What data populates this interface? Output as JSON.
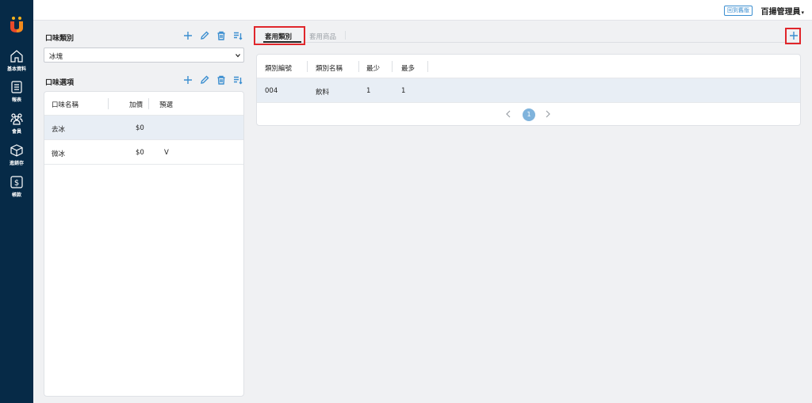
{
  "sidebar": {
    "items": [
      {
        "label": "基本資料",
        "icon": "home-icon"
      },
      {
        "label": "報表",
        "icon": "report-icon"
      },
      {
        "label": "會員",
        "icon": "members-icon"
      },
      {
        "label": "進銷存",
        "icon": "inventory-box-icon"
      },
      {
        "label": "帳款",
        "icon": "dollar-icon"
      }
    ]
  },
  "topbar": {
    "back_label": "回到舊版",
    "user_label": "百揚管理員",
    "caret": "▾"
  },
  "flavor_category": {
    "title": "口味類別",
    "selected": "冰塊"
  },
  "flavor_options": {
    "title": "口味選項",
    "columns": [
      "口味名稱",
      "加價",
      "預選"
    ],
    "rows": [
      {
        "name": "去冰",
        "price": "$0",
        "default": ""
      },
      {
        "name": "微冰",
        "price": "$0",
        "default": "V"
      }
    ]
  },
  "tabs": {
    "active": "套用類別",
    "inactive": "套用商品"
  },
  "category_table": {
    "columns": [
      "類別編號",
      "類別名稱",
      "最少",
      "最多"
    ],
    "rows": [
      {
        "code": "004",
        "name": "飲料",
        "min": "1",
        "max": "1"
      }
    ],
    "current_page": "1"
  },
  "colors": {
    "sidebar_bg": "#062a47",
    "accent": "#3b8ed0",
    "highlight_box": "#e0262b",
    "selected_row": "#e8eef5"
  }
}
